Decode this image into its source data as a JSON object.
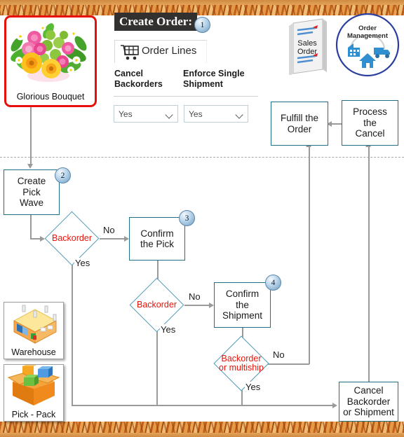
{
  "product": {
    "label": "Glorious Bouquet",
    "icon": "bouquet-image",
    "highlight_color": "#e8110a"
  },
  "header": {
    "title": "Create Order:",
    "step_badge": "1",
    "tab_label": "Order Lines",
    "tab_icon": "shopping-cart-icon",
    "columns": [
      {
        "label_line1": "Cancel",
        "label_line2": "Backorders",
        "value": "Yes"
      },
      {
        "label_line1": "Enforce Single",
        "label_line2": "Shipment",
        "value": "Yes"
      }
    ]
  },
  "icons": {
    "sales_order": {
      "line1": "Sales",
      "line2": "Order",
      "name": "sales-order-document-icon"
    },
    "order_management": {
      "line1": "Order",
      "line2": "Management",
      "name": "order-management-icon"
    }
  },
  "tiles": [
    {
      "caption": "Warehouse",
      "icon": "warehouse-icon"
    },
    {
      "caption": "Pick - Pack",
      "icon": "pick-pack-box-icon"
    }
  ],
  "flow": {
    "nodes": [
      {
        "id": "create-pick-wave",
        "text": "Create\nPick\nWave",
        "badge": "2"
      },
      {
        "id": "confirm-the-pick",
        "text": "Confirm\nthe Pick",
        "badge": "3"
      },
      {
        "id": "confirm-the-shipment",
        "text": "Confirm\nthe\nShipment",
        "badge": "4"
      },
      {
        "id": "fulfill-the-order",
        "text": "Fulfill the\nOrder",
        "badge": ""
      },
      {
        "id": "process-the-cancel",
        "text": "Process\nthe\nCancel",
        "badge": ""
      },
      {
        "id": "cancel-backorder-or-shipment",
        "text": "Cancel\nBackorder\nor Shipment",
        "badge": ""
      }
    ],
    "decisions": [
      {
        "id": "backorder-1",
        "line1": "Backorder",
        "line2": ""
      },
      {
        "id": "backorder-2",
        "line1": "Backorder",
        "line2": ""
      },
      {
        "id": "backorder-or-multiship",
        "line1": "Backorder",
        "line2": "or multiship"
      }
    ],
    "edge_labels": {
      "no_1": "No",
      "yes_1": "Yes",
      "no_2": "No",
      "yes_2": "Yes",
      "no_3": "No",
      "yes_3": "Yes"
    },
    "colors": {
      "node_border": "#1f6f86",
      "decision_border": "#4f9cb4",
      "decision_text": "#e8140a",
      "connector": "#9a9a9a"
    }
  }
}
